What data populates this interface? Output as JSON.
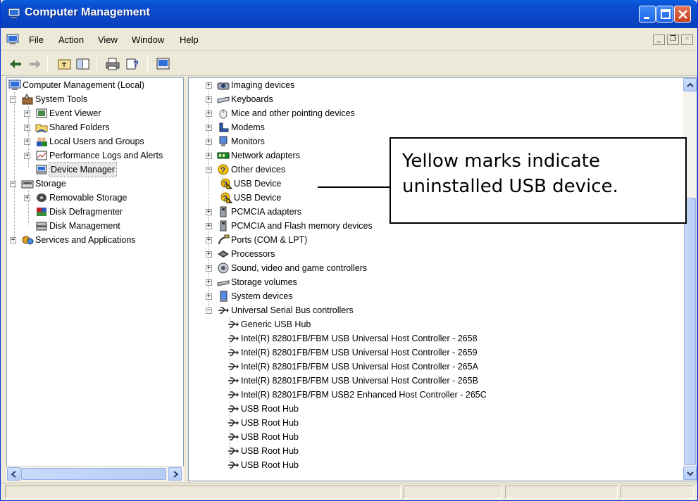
{
  "window": {
    "title": "Computer Management"
  },
  "menu": {
    "items": [
      "File",
      "Action",
      "View",
      "Window",
      "Help"
    ]
  },
  "mdi": {
    "minimize": "_",
    "restore": "❐",
    "close": "×"
  },
  "toolbar": {
    "buttons": [
      "back-arrow-icon",
      "forward-arrow-icon",
      "up-folder-icon",
      "show-hide-tree-icon",
      "print-icon",
      "help-icon",
      "properties-icon"
    ]
  },
  "tree": {
    "root": "Computer Management (Local)",
    "system_tools": "System Tools",
    "event_viewer": "Event Viewer",
    "shared_folders": "Shared Folders",
    "local_users": "Local Users and Groups",
    "perf_logs": "Performance Logs and Alerts",
    "device_manager": "Device Manager",
    "storage": "Storage",
    "removable_storage": "Removable Storage",
    "disk_defrag": "Disk Defragmenter",
    "disk_mgmt": "Disk Management",
    "services_apps": "Services and Applications"
  },
  "devices": {
    "imaging": "Imaging devices",
    "keyboards": "Keyboards",
    "mice": "Mice and other pointing devices",
    "modems": "Modems",
    "monitors": "Monitors",
    "network": "Network adapters",
    "other": "Other devices",
    "usb_device_1": "USB Device",
    "usb_device_2": "USB Device",
    "pcmcia": "PCMCIA adapters",
    "pcmcia_flash": "PCMCIA and Flash memory devices",
    "ports": "Ports (COM & LPT)",
    "processors": "Processors",
    "sound": "Sound, video and game controllers",
    "storage_volumes": "Storage volumes",
    "system_devices": "System devices",
    "usb_controllers": "Universal Serial Bus controllers",
    "usb_children": [
      "Generic USB Hub",
      "Intel(R) 82801FB/FBM USB Universal Host Controller - 2658",
      "Intel(R) 82801FB/FBM USB Universal Host Controller - 2659",
      "Intel(R) 82801FB/FBM USB Universal Host Controller - 265A",
      "Intel(R) 82801FB/FBM USB Universal Host Controller - 265B",
      "Intel(R) 82801FB/FBM USB2 Enhanced Host Controller - 265C",
      "USB Root Hub",
      "USB Root Hub",
      "USB Root Hub",
      "USB Root Hub",
      "USB Root Hub"
    ]
  },
  "callout": {
    "line1": "Yellow marks indicate",
    "line2": "uninstalled USB device."
  },
  "colors": {
    "titlebar": "#0a4fd1",
    "window_bg": "#ece9d8",
    "warning": "#f5c400"
  }
}
